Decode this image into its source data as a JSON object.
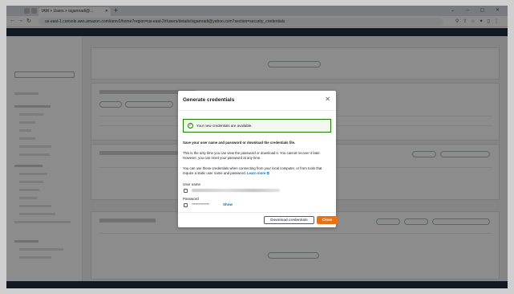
{
  "browser": {
    "tab_title": "IAM > Users > isgamradi@...",
    "url": "us-east-1.console.aws.amazon.com/iamv2/home?region=us-east-2#/users/details/isgamradi@yahoo.com?section=security_credentials"
  },
  "modal": {
    "title": "Generate credentials",
    "success_message": "Your new credentials are available.",
    "instruction": "Save your user name and password or download the credentials file.",
    "para1": "This is the only time you can view the password or download it. You cannot recover it later. However, you can reset your password at any time.",
    "para2": "You can use these credentials when connecting from your local computer, or from tools that require a static user name and password.",
    "learn_more": "Learn more",
    "username_label": "User name",
    "password_label": "Password",
    "password_mask": "***************",
    "show_label": "Show",
    "download_label": "Download credentials",
    "close_label": "Close"
  },
  "colors": {
    "accent": "#ec7211",
    "link": "#0073bb",
    "success": "#1d8102"
  }
}
